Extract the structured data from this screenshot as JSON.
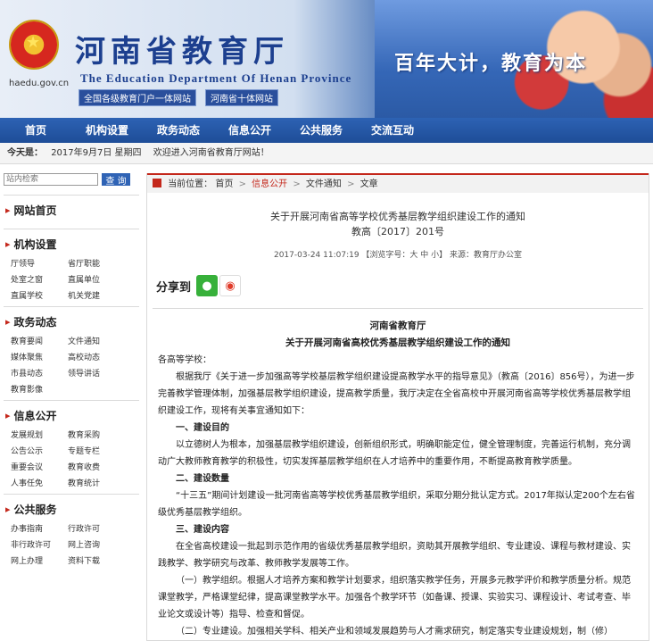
{
  "header": {
    "site_url": "haedu.gov.cn",
    "title_cn": "河南省教育厅",
    "title_en": "The Education Department Of Henan Province",
    "link1": "全国各级教育门户一体网站",
    "link2": "河南省十体网站",
    "slogan": "百年大计，教育为本"
  },
  "nav": [
    "首页",
    "机构设置",
    "政务动态",
    "信息公开",
    "公共服务",
    "交流互动"
  ],
  "datebar": {
    "label": "今天是：",
    "date": "2017年9月7日 星期四",
    "welcome": "欢迎进入河南省教育厅网站！"
  },
  "search": {
    "placeholder": "站内检索",
    "button": "查 询"
  },
  "sidebar": {
    "home": "网站首页",
    "sections": [
      {
        "title": "机构设置",
        "items": [
          "厅领导",
          "省厅职能",
          "处室之窗",
          "直属单位",
          "直属学校",
          "机关党建"
        ]
      },
      {
        "title": "政务动态",
        "items": [
          "教育要闻",
          "文件通知",
          "媒体聚焦",
          "高校动态",
          "市县动态",
          "领导讲话",
          "教育影像"
        ]
      },
      {
        "title": "信息公开",
        "items": [
          "发展规划",
          "教育采购",
          "公告公示",
          "专题专栏",
          "重要会议",
          "教育收费",
          "人事任免",
          "教育统计"
        ]
      },
      {
        "title": "公共服务",
        "items": [
          "办事指南",
          "行政许可",
          "非行政许可",
          "网上咨询",
          "网上办理",
          "资料下载"
        ]
      }
    ]
  },
  "breadcrumb": {
    "label": "当前位置：",
    "items": [
      "首页",
      "信息公开",
      "文件通知",
      "文章"
    ]
  },
  "doc": {
    "title_line1": "关于开展河南省高等学校优秀基层教学组织建设工作的通知",
    "title_line2": "教高〔2017〕201号",
    "meta": "2017-03-24 11:07:19 【浏览字号：大 中 小】 来源：教育厅办公室"
  },
  "share": {
    "label": "分享到"
  },
  "article": {
    "org": "河南省教育厅",
    "heading": "关于开展河南省高校优秀基层教学组织建设工作的通知",
    "salutation": "各高等学校：",
    "p1": "根据我厅《关于进一步加强高等学校基层教学组织建设提高教学水平的指导意见》（教高〔2016〕856号），为进一步完善教学管理体制，加强基层教学组织建设，提高教学质量，我厅决定在全省高校中开展河南省高等学校优秀基层教学组织建设工作，现将有关事宜通知如下：",
    "h1": "一、建设目的",
    "p2": "以立德树人为根本，加强基层教学组织建设，创新组织形式，明确职能定位，健全管理制度，完善运行机制，充分调动广大教师教育教学的积极性，切实发挥基层教学组织在人才培养中的重要作用，不断提高教育教学质量。",
    "h2": "二、建设数量",
    "p3": "“十三五”期间计划建设一批河南省高等学校优秀基层教学组织，采取分期分批认定方式。2017年拟认定200个左右省级优秀基层教学组织。",
    "h3": "三、建设内容",
    "p4": "在全省高校建设一批起到示范作用的省级优秀基层教学组织，资助其开展教学组织、专业建设、课程与教材建设、实践教学、教学研究与改革、教师教学发展等工作。",
    "p5": "（一）教学组织。根据人才培养方案和教学计划要求，组织落实教学任务，开展多元教学评价和教学质量分析。规范课堂教学，严格课堂纪律，提高课堂教学水平。加强各个教学环节（如备课、授课、实验实习、课程设计、考试考查、毕业论文或设计等）指导、检查和督促。",
    "p6": "（二）专业建设。加强相关学科、相关产业和领域发展趋势与人才需求研究，制定落实专业建设规划，制（修）"
  }
}
